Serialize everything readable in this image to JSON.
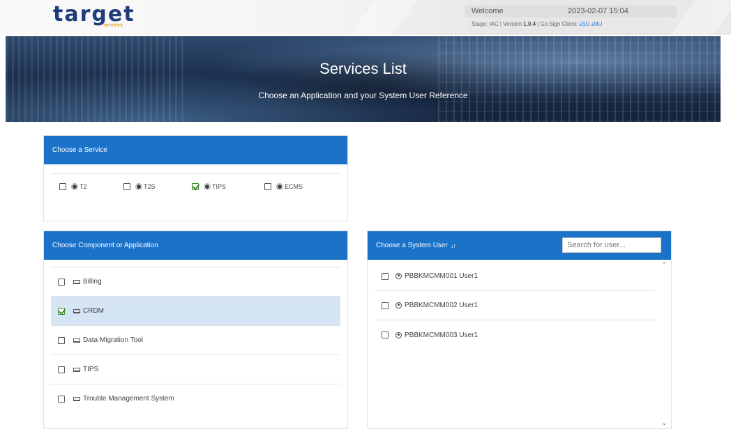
{
  "header": {
    "logo": "target",
    "logo_sub": "services",
    "welcome": "Welcome",
    "datetime": "2023-02-07 15:04",
    "stage_label": "Stage: IAC | Version",
    "version": "1.0.4",
    "go_sign": "| Go Sign Client:",
    "su_link": "SU",
    "mu_link": "MU"
  },
  "banner": {
    "title": "Services List",
    "subtitle": "Choose an Application and your System User Reference"
  },
  "service_panel": {
    "heading": "Choose a Service",
    "services": [
      {
        "label": "T2",
        "checked": false
      },
      {
        "label": "T2S",
        "checked": false
      },
      {
        "label": "TIPS",
        "checked": true
      },
      {
        "label": "ECMS",
        "checked": false
      }
    ]
  },
  "component_panel": {
    "heading": "Choose Component or Application",
    "items": [
      {
        "label": "Billing",
        "checked": false
      },
      {
        "label": "CRDM",
        "checked": true
      },
      {
        "label": "Data Migration Tool",
        "checked": false
      },
      {
        "label": "TIPS",
        "checked": false
      },
      {
        "label": "Trouble Management System",
        "checked": false
      }
    ]
  },
  "user_panel": {
    "heading": "Choose a System User",
    "search_placeholder": "Search for user...",
    "users": [
      {
        "label": "PBBKMCMM001 User1",
        "checked": false
      },
      {
        "label": "PBBKMCMM002 User1",
        "checked": false
      },
      {
        "label": "PBBKMCMM003 User1",
        "checked": false
      }
    ]
  },
  "icons": {
    "service": "gear-icon",
    "component": "laptop-icon",
    "user": "user-circle-icon",
    "sort": "sort-alpha-icon",
    "download": "download-icon"
  },
  "colors": {
    "panel_header": "#1b73c9",
    "selected_row": "#d6e5f3",
    "check": "#3d8b28",
    "logo": "#1f3d7a"
  }
}
